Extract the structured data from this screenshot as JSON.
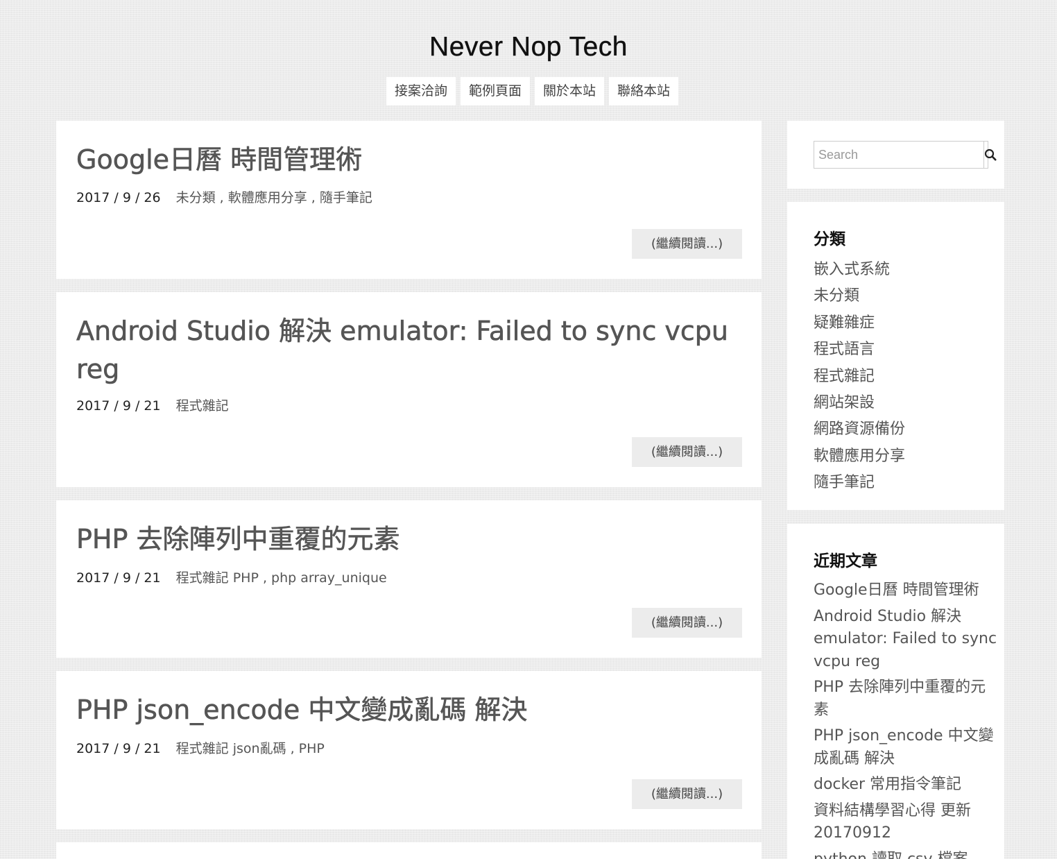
{
  "site": {
    "title": "Never Nop Tech"
  },
  "menu": [
    {
      "label": "接案洽詢"
    },
    {
      "label": "範例頁面"
    },
    {
      "label": "關於本站"
    },
    {
      "label": "聯絡本站"
    }
  ],
  "posts": [
    {
      "title": "Google日曆 時間管理術",
      "date": "2017 / 9 / 26",
      "categories": "未分類 , 軟體應用分享 , 隨手筆記",
      "tags": "",
      "read_more": "(繼續閱讀...)"
    },
    {
      "title": "Android Studio 解決 emulator: Failed to sync vcpu reg",
      "date": "2017 / 9 / 21",
      "categories": "程式雜記",
      "tags": "",
      "read_more": "(繼續閱讀...)"
    },
    {
      "title": "PHP 去除陣列中重覆的元素",
      "date": "2017 / 9 / 21",
      "categories": "程式雜記",
      "tags": "PHP , php array_unique",
      "read_more": "(繼續閱讀...)"
    },
    {
      "title": "PHP json_encode 中文變成亂碼 解決",
      "date": "2017 / 9 / 21",
      "categories": "程式雜記",
      "tags": "json亂碼 , PHP",
      "read_more": "(繼續閱讀...)"
    }
  ],
  "sidebar": {
    "search": {
      "placeholder": "Search",
      "icon": "search-icon"
    },
    "categories": {
      "title": "分類",
      "items": [
        "嵌入式系統",
        "未分類",
        "疑難雜症",
        "程式語言",
        "程式雜記",
        "網站架設",
        "網路資源備份",
        "軟體應用分享",
        "隨手筆記"
      ]
    },
    "recent": {
      "title": "近期文章",
      "items": [
        "Google日曆 時間管理術",
        "Android Studio 解決 emulator: Failed to sync vcpu reg",
        "PHP 去除陣列中重覆的元素",
        "PHP json_encode 中文變成亂碼 解決",
        "docker 常用指令筆記",
        "資料結構學習心得 更新 20170912",
        "python 讀取 csv 檔案"
      ]
    }
  }
}
